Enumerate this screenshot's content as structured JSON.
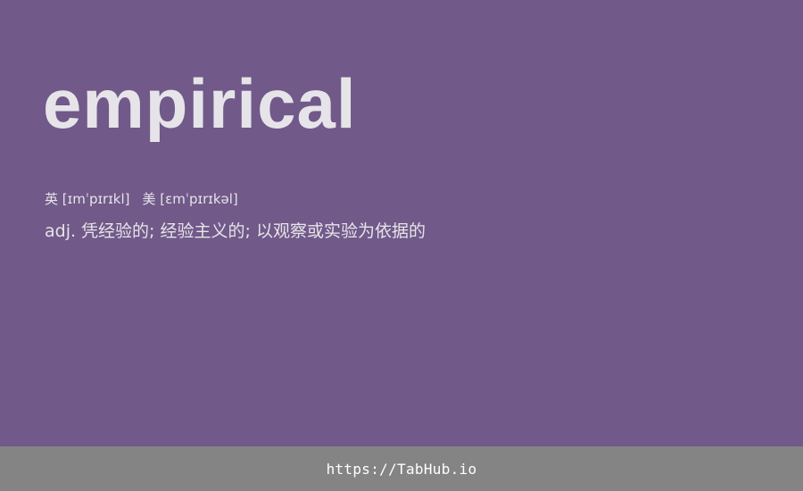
{
  "card": {
    "word": "empirical",
    "phonetic_uk_label": "英",
    "phonetic_uk": "[ɪmˈpɪrɪkl]",
    "phonetic_us_label": "美",
    "phonetic_us": "[ɛmˈpɪrɪkəl]",
    "definition": "adj. 凭经验的; 经验主义的; 以观察或实验为依据的"
  },
  "footer": {
    "link": "https://TabHub.io"
  },
  "colors": {
    "background": "#715989",
    "text": "#e6e4e9",
    "footer_background": "#848484",
    "footer_text": "#ffffff"
  }
}
